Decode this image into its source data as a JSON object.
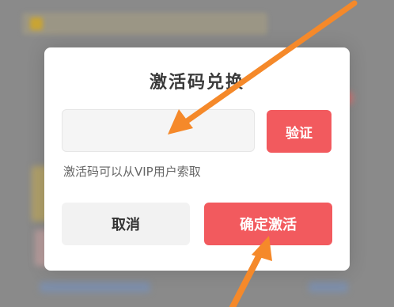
{
  "dialog": {
    "title": "激活码兑换",
    "code_input": {
      "value": "",
      "placeholder": ""
    },
    "verify_label": "验证",
    "hint": "激活码可以从VIP用户索取",
    "cancel_label": "取消",
    "confirm_label": "确定激活"
  },
  "colors": {
    "accent": "#f25a5e",
    "arrow": "#f5892a"
  },
  "annotations": {
    "arrow_icon": "arrow-icon"
  }
}
